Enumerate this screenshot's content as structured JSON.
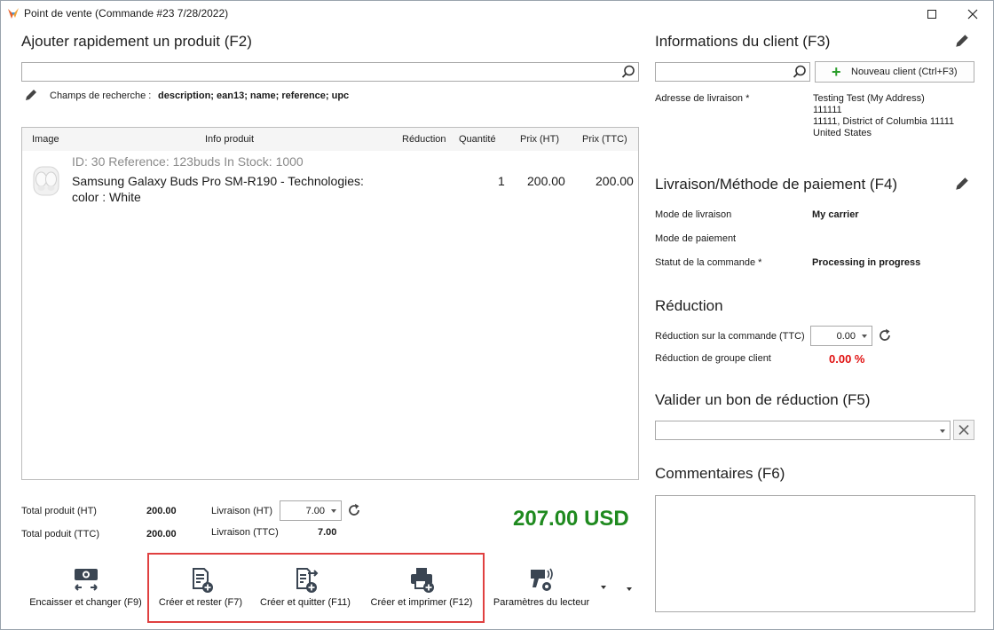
{
  "window": {
    "title": "Point de vente (Commande #23 7/28/2022)"
  },
  "quick_add": {
    "title": "Ajouter rapidement un produit (F2)",
    "search_value": "",
    "search_fields_label": "Champs de recherche :",
    "search_fields_value": "description; ean13; name; reference; upc"
  },
  "grid": {
    "columns": [
      "Image",
      "Info produit",
      "Réduction",
      "Quantité",
      "Prix (HT)",
      "Prix (TTC)"
    ],
    "rows": [
      {
        "meta": "ID: 30 Reference: 123buds In Stock: 1000",
        "name_line1": "Samsung Galaxy Buds Pro SM-R190  - Technologies:",
        "name_line2": "color : White",
        "quantity": "1",
        "price_ht": "200.00",
        "price_ttc": "200.00"
      }
    ]
  },
  "totals": {
    "produit_ht_label": "Total produit (HT)",
    "produit_ht_value": "200.00",
    "produit_ttc_label": "Total poduit (TTC)",
    "produit_ttc_value": "200.00",
    "livraison_ht_label": "Livraison (HT)",
    "livraison_ht_value": "7.00",
    "livraison_ttc_label": "Livraison (TTC)",
    "livraison_ttc_value": "7.00",
    "grand_total": "207.00 USD"
  },
  "toolbar": {
    "encaisser": "Encaisser et changer (F9)",
    "creer_rester": "Créer et rester (F7)",
    "creer_quitter": "Créer et quitter (F11)",
    "creer_imprimer": "Créer et imprimer (F12)",
    "parametres": "Paramètres du lecteur"
  },
  "client": {
    "title": "Informations du client (F3)",
    "search_value": "",
    "new_client_label": "Nouveau client (Ctrl+F3)",
    "address_label": "Adresse de livraison *",
    "address_lines": [
      "Testing Test (My Address)",
      "111111",
      "11111, District of Columbia 11111",
      "United States"
    ]
  },
  "shipping_payment": {
    "title": "Livraison/Méthode de paiement (F4)",
    "mode_livraison_label": "Mode de livraison",
    "mode_livraison_value": "My carrier",
    "mode_paiement_label": "Mode de paiement",
    "mode_paiement_value": "",
    "statut_label": "Statut de la commande *",
    "statut_value": "Processing in progress"
  },
  "reduction": {
    "title": "Réduction",
    "commande_label": "Réduction sur la commande (TTC)",
    "commande_value": "0.00",
    "groupe_label": "Réduction de groupe client",
    "groupe_value": "0.00 %"
  },
  "voucher": {
    "title": "Valider un bon de réduction (F5)",
    "value": ""
  },
  "comments": {
    "title": "Commentaires (F6)",
    "value": ""
  },
  "colors": {
    "grand_total": "#1f8a1f",
    "group_discount": "#e01010",
    "highlight_border": "#e04040",
    "add_green": "#2a9d2a"
  }
}
